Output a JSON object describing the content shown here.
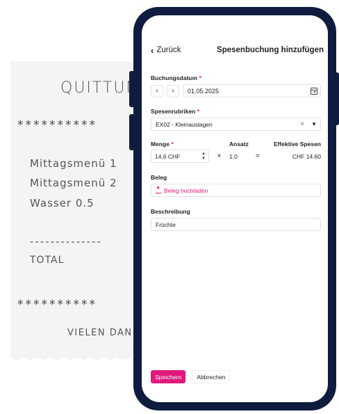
{
  "receipt": {
    "title": "QUITTUN",
    "stars": "**********",
    "items": [
      "Mittagsmenü 1",
      "Mittagsmenü 2",
      "Wasser 0.5"
    ],
    "divider": "--------------",
    "total_label": "TOTAL",
    "thanks": "VIELEN DAN"
  },
  "header": {
    "back_label": "Zurück",
    "title": "Spesenbuchung hinzufügen"
  },
  "buchungsdatum": {
    "label": "Buchungsdatum",
    "required": "*",
    "prev": "‹",
    "next": "›",
    "value": "01.05.2025"
  },
  "spesenrubriken": {
    "label": "Spesenrubriken",
    "required": "*",
    "value": "EX02 - Kleinauslagen",
    "clear_glyph": "×",
    "caret_glyph": "▼"
  },
  "menge": {
    "label": "Menge",
    "required": "*",
    "ansatz_label": "Ansatz",
    "effektive_label": "Effektive Spesen",
    "value": "14.6 CHF",
    "times": "×",
    "ansatz_value": "1.0",
    "equals": "=",
    "effektive_value": "CHF 14.60"
  },
  "beleg": {
    "label": "Beleg",
    "upload_label": "Beleg hochladen"
  },
  "beschreibung": {
    "label": "Beschreibung",
    "value": "Früchte"
  },
  "actions": {
    "save_label": "Speichern",
    "cancel_label": "Abbrechen"
  },
  "colors": {
    "accent": "#e0197d",
    "phone_frame": "#0f1c3f",
    "receipt_bg": "#f4f4f4"
  }
}
